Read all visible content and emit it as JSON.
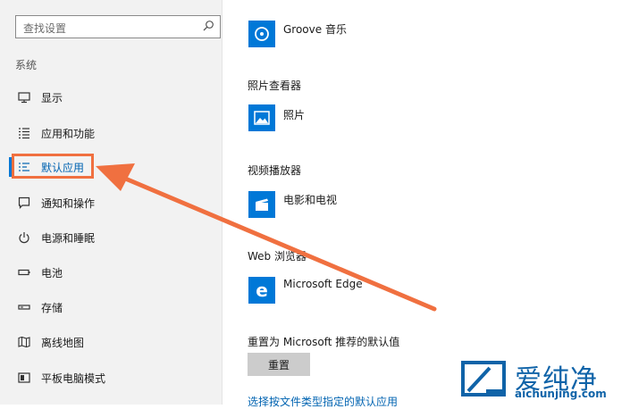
{
  "sidebar": {
    "search_placeholder": "查找设置",
    "section_label": "系统",
    "items": [
      {
        "label": "显示",
        "icon": "monitor-icon"
      },
      {
        "label": "应用和功能",
        "icon": "list-icon"
      },
      {
        "label": "默认应用",
        "icon": "default-apps-icon",
        "active": true
      },
      {
        "label": "通知和操作",
        "icon": "notification-icon"
      },
      {
        "label": "电源和睡眠",
        "icon": "power-icon"
      },
      {
        "label": "电池",
        "icon": "battery-icon"
      },
      {
        "label": "存储",
        "icon": "storage-icon"
      },
      {
        "label": "离线地图",
        "icon": "map-icon"
      },
      {
        "label": "平板电脑模式",
        "icon": "tablet-icon"
      }
    ]
  },
  "main": {
    "music_app": "Groove 音乐",
    "photo_viewer_heading": "照片查看器",
    "photo_app": "照片",
    "video_player_heading": "视频播放器",
    "video_app": "电影和电视",
    "browser_heading": "Web 浏览器",
    "browser_app": "Microsoft Edge",
    "reset_heading": "重置为 Microsoft 推荐的默认值",
    "reset_button": "重置",
    "file_type_link": "选择按文件类型指定的默认应用"
  },
  "watermark": {
    "chinese": "爱纯净",
    "url": "aichunjing.com"
  },
  "colors": {
    "accent": "#0078d7",
    "highlight": "#f07040",
    "sidebar_bg": "#f2f2f2",
    "link": "#0063b1",
    "watermark": "#0f63a8"
  }
}
